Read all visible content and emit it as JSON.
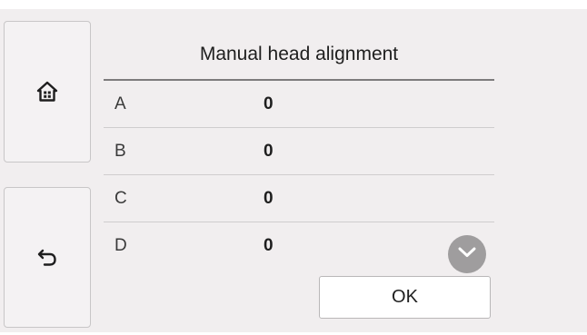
{
  "screen": {
    "title": "Manual head alignment"
  },
  "nav": {
    "home_icon": "home-icon",
    "back_icon": "back-arrow-icon"
  },
  "rows": [
    {
      "label": "A",
      "value": "0"
    },
    {
      "label": "B",
      "value": "0"
    },
    {
      "label": "C",
      "value": "0"
    },
    {
      "label": "D",
      "value": "0"
    }
  ],
  "scroll": {
    "icon": "chevron-down-icon"
  },
  "actions": {
    "ok_label": "OK"
  },
  "colors": {
    "screen_background": "#f1eeef",
    "scroll_button": "#9f9d9e",
    "divider": "#cfcdce"
  }
}
